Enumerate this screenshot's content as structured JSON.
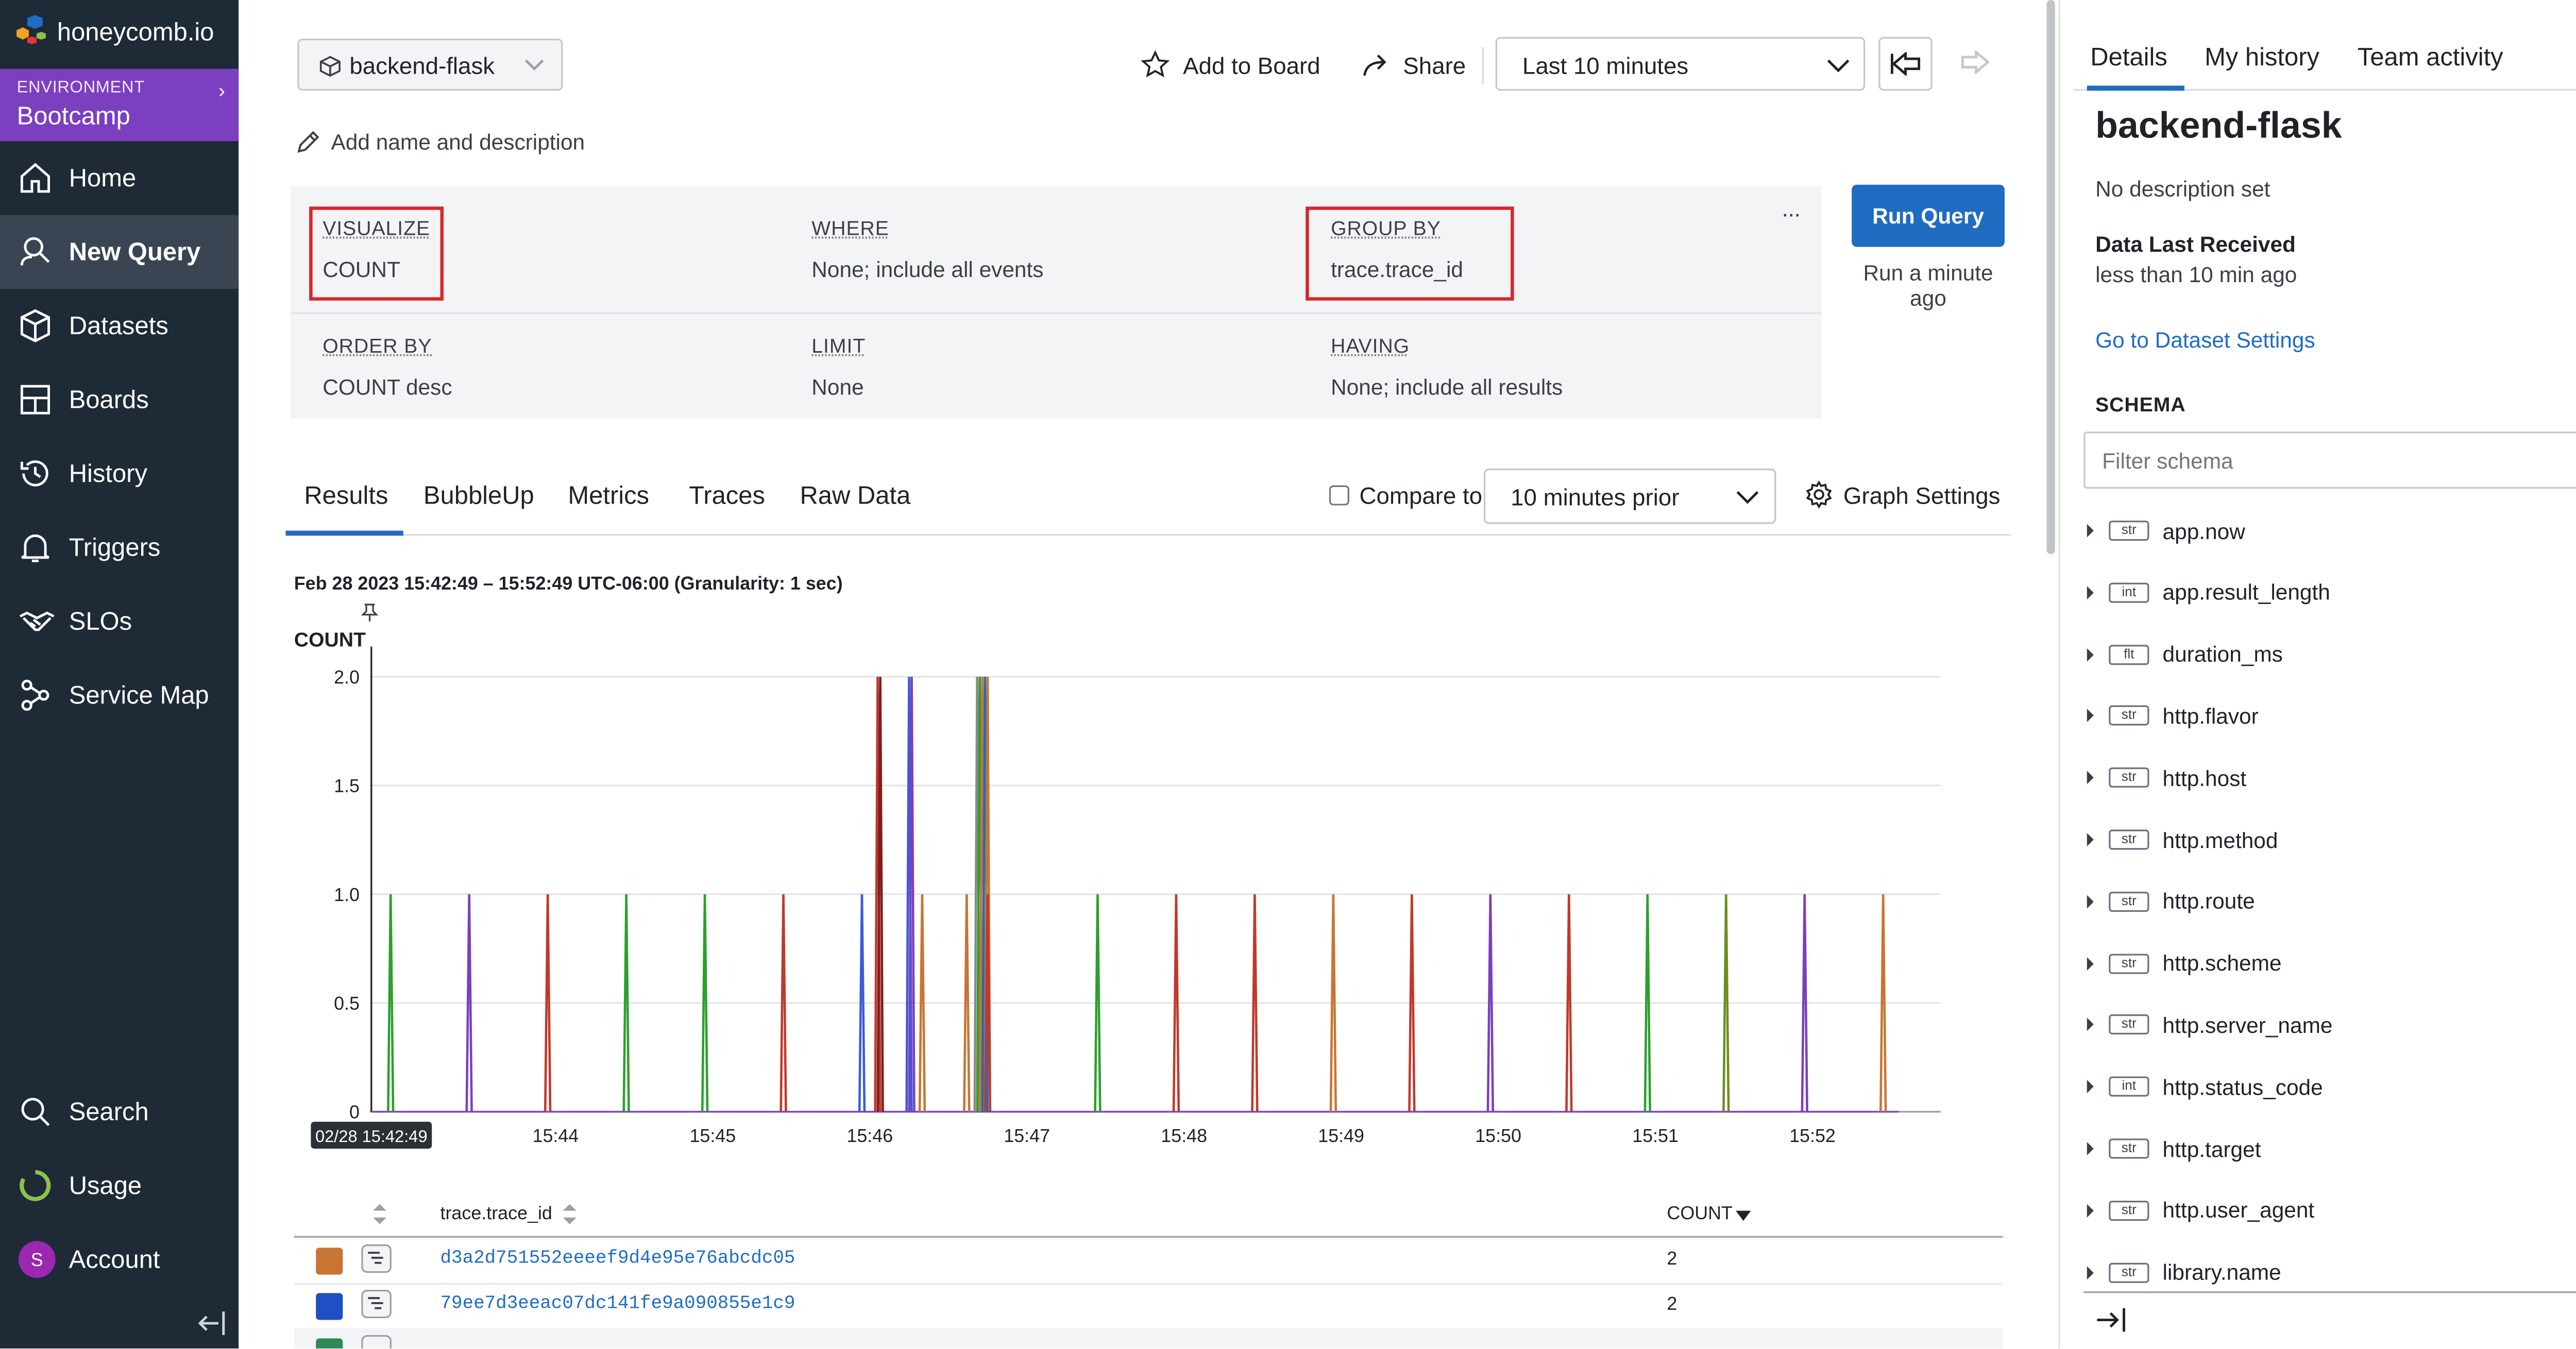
{
  "brand": {
    "logo_text": "honeycomb.io"
  },
  "environment": {
    "label": "ENVIRONMENT",
    "name": "Bootcamp"
  },
  "sidebar": {
    "items": [
      {
        "label": "Home",
        "icon": "home-icon"
      },
      {
        "label": "New Query",
        "icon": "query-icon",
        "active": true
      },
      {
        "label": "Datasets",
        "icon": "cube-icon"
      },
      {
        "label": "Boards",
        "icon": "board-icon"
      },
      {
        "label": "History",
        "icon": "history-icon"
      },
      {
        "label": "Triggers",
        "icon": "bell-icon"
      },
      {
        "label": "SLOs",
        "icon": "handshake-icon"
      },
      {
        "label": "Service Map",
        "icon": "service-map-icon"
      }
    ],
    "bottom": [
      {
        "label": "Search",
        "icon": "search-icon"
      },
      {
        "label": "Usage",
        "icon": "usage-icon"
      },
      {
        "label": "Account",
        "icon": "avatar",
        "avatar_letter": "S"
      }
    ]
  },
  "header": {
    "dataset": "backend-flask",
    "add_to_board": "Add to Board",
    "share": "Share",
    "time_range": "Last 10 minutes",
    "add_name": "Add name and description"
  },
  "query": {
    "visualize": {
      "label": "VISUALIZE",
      "value": "COUNT"
    },
    "where": {
      "label": "WHERE",
      "value": "None; include all events"
    },
    "group_by": {
      "label": "GROUP BY",
      "value": "trace.trace_id"
    },
    "order_by": {
      "label": "ORDER BY",
      "value": "COUNT desc"
    },
    "limit": {
      "label": "LIMIT",
      "value": "None"
    },
    "having": {
      "label": "HAVING",
      "value": "None; include all results"
    },
    "run_label": "Run Query",
    "run_ago": "Run a minute ago",
    "more": "···"
  },
  "results": {
    "tabs": [
      "Results",
      "BubbleUp",
      "Metrics",
      "Traces",
      "Raw Data"
    ],
    "active_tab": "Results",
    "compare_label": "Compare to",
    "compare_value": "10 minutes prior",
    "graph_settings": "Graph Settings",
    "range_label": "Feb 28 2023 15:42:49 – 15:52:49 UTC-06:00 (Granularity: 1 sec)"
  },
  "chart_data": {
    "type": "line",
    "ylabel": "COUNT",
    "ylim": [
      0,
      2
    ],
    "yticks": [
      "0",
      "0.5",
      "1.0",
      "1.5",
      "2.0"
    ],
    "xlim": [
      "15:42:49",
      "15:52:49"
    ],
    "xticks": [
      "15:44",
      "15:45",
      "15:46",
      "15:47",
      "15:48",
      "15:49",
      "15:50",
      "15:51",
      "15:52"
    ],
    "x_start_label": "02/28 15:42:49",
    "grid": true,
    "spikes": [
      {
        "t": "15:42:57",
        "v": 1,
        "color": "#2ca02c"
      },
      {
        "t": "15:43:27",
        "v": 1,
        "color": "#7b3fbf"
      },
      {
        "t": "15:43:57",
        "v": 1,
        "color": "#c0392b"
      },
      {
        "t": "15:44:27",
        "v": 1,
        "color": "#2ca02c"
      },
      {
        "t": "15:44:57",
        "v": 1,
        "color": "#2ca02c"
      },
      {
        "t": "15:45:27",
        "v": 1,
        "color": "#c0392b"
      },
      {
        "t": "15:45:57",
        "v": 1,
        "color": "#3b5bdb"
      },
      {
        "t": "15:46:03",
        "v": 2,
        "color": "#c0392b"
      },
      {
        "t": "15:46:04",
        "v": 2,
        "color": "#7f1d1d"
      },
      {
        "t": "15:46:15",
        "v": 2,
        "color": "#3b5bdb"
      },
      {
        "t": "15:46:16",
        "v": 2,
        "color": "#7b3fbf"
      },
      {
        "t": "15:46:20",
        "v": 1,
        "color": "#c87533"
      },
      {
        "t": "15:46:37",
        "v": 1,
        "color": "#c87533"
      },
      {
        "t": "15:46:41",
        "v": 2,
        "color": "#8a8a8a"
      },
      {
        "t": "15:46:42",
        "v": 2,
        "color": "#2ca02c"
      },
      {
        "t": "15:46:43",
        "v": 2,
        "color": "#c87533"
      },
      {
        "t": "15:46:44",
        "v": 2,
        "color": "#1f6cc2"
      },
      {
        "t": "15:46:45",
        "v": 2,
        "color": "#c87533"
      },
      {
        "t": "15:46:45",
        "v": 1,
        "color": "#c0392b"
      },
      {
        "t": "15:47:27",
        "v": 1,
        "color": "#2ca02c"
      },
      {
        "t": "15:47:57",
        "v": 1,
        "color": "#c0392b"
      },
      {
        "t": "15:48:27",
        "v": 1,
        "color": "#c0392b"
      },
      {
        "t": "15:48:57",
        "v": 1,
        "color": "#c87533"
      },
      {
        "t": "15:49:27",
        "v": 1,
        "color": "#c0392b"
      },
      {
        "t": "15:49:57",
        "v": 1,
        "color": "#7b3fbf"
      },
      {
        "t": "15:50:27",
        "v": 1,
        "color": "#c0392b"
      },
      {
        "t": "15:50:57",
        "v": 1,
        "color": "#2ca02c"
      },
      {
        "t": "15:51:27",
        "v": 1,
        "color": "#6b8e23"
      },
      {
        "t": "15:51:57",
        "v": 1,
        "color": "#7b3fbf"
      },
      {
        "t": "15:52:27",
        "v": 1,
        "color": "#c87533"
      }
    ]
  },
  "table": {
    "col_group": "trace.trace_id",
    "col_count": "COUNT",
    "rows": [
      {
        "trace_id": "d3a2d751552eeeef9d4e95e76abcdc05",
        "count": "2",
        "color": "#c87533"
      },
      {
        "trace_id": "79ee7d3eeac07dc141fe9a090855e1c9",
        "count": "2",
        "color": "#1f4fc2"
      },
      {
        "trace_id": "",
        "count": "",
        "color": "#2e8b57"
      }
    ]
  },
  "details": {
    "tabs": [
      "Details",
      "My history",
      "Team activity"
    ],
    "title": "backend-flask",
    "description": "No description set",
    "data_last_received_label": "Data Last Received",
    "data_last_received_value": "less than 10 min ago",
    "settings_link": "Go to Dataset Settings",
    "schema_heading": "SCHEMA",
    "filter_placeholder": "Filter schema",
    "schema": [
      {
        "type": "str",
        "name": "app.now"
      },
      {
        "type": "int",
        "name": "app.result_length"
      },
      {
        "type": "flt",
        "name": "duration_ms"
      },
      {
        "type": "str",
        "name": "http.flavor"
      },
      {
        "type": "str",
        "name": "http.host"
      },
      {
        "type": "str",
        "name": "http.method"
      },
      {
        "type": "str",
        "name": "http.route"
      },
      {
        "type": "str",
        "name": "http.scheme"
      },
      {
        "type": "str",
        "name": "http.server_name"
      },
      {
        "type": "int",
        "name": "http.status_code"
      },
      {
        "type": "str",
        "name": "http.target"
      },
      {
        "type": "str",
        "name": "http.user_agent"
      },
      {
        "type": "str",
        "name": "library.name"
      }
    ]
  }
}
